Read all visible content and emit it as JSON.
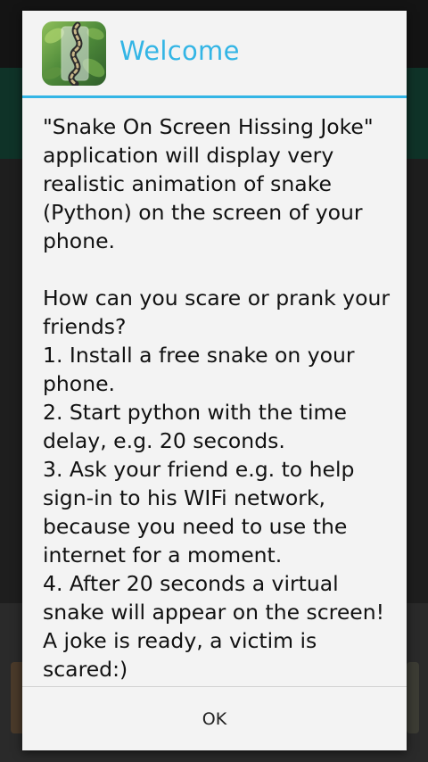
{
  "dialog": {
    "title": "Welcome",
    "icon": "snake-app-icon",
    "message": {
      "intro": "\"Snake On Screen Hissing Joke\" application will display very realistic animation of snake (Python) on the screen of your phone.",
      "question": "How can you scare or prank your friends?",
      "steps": [
        "1. Install a free snake on your phone.",
        "2. Start python with the time delay, e.g. 20 seconds.",
        "3. Ask your friend e.g. to help sign-in to his WIFi network, because you need to use the internet for a moment.",
        "4. After 20 seconds a virtual snake will appear on the screen! A joke is ready, a victim is scared:)"
      ]
    },
    "ok_label": "OK"
  },
  "colors": {
    "accent": "#33b5e5",
    "dialog_background": "#f3f3f3",
    "text": "#111111",
    "scrim": "#1f1f1f"
  }
}
